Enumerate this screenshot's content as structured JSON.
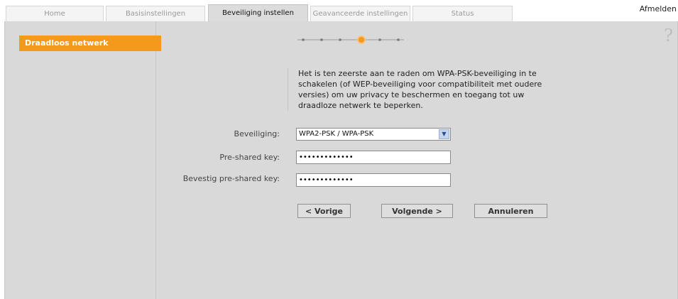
{
  "tabs": [
    {
      "label": "Home",
      "active": false
    },
    {
      "label": "Basisinstellingen",
      "active": false
    },
    {
      "label": "Beveiliging instellen",
      "active": true
    },
    {
      "label": "Geavanceerde instellingen",
      "active": false
    },
    {
      "label": "Status",
      "active": false
    }
  ],
  "header": {
    "logout_label": "Afmelden"
  },
  "sidebar": {
    "items": [
      {
        "label": "Draadloos netwerk",
        "active": true
      }
    ]
  },
  "help": {
    "symbol": "?"
  },
  "wizard": {
    "total_steps": 6,
    "current_step": 4
  },
  "intro_text": "Het is ten zeerste aan te raden om WPA-PSK-beveiliging in te schakelen (of WEP-beveiliging voor compatibiliteit met oudere versies) om uw privacy te beschermen en toegang tot uw draadloze netwerk te beperken.",
  "form": {
    "security": {
      "label": "Beveiliging:",
      "value": "WPA2-PSK / WPA-PSK"
    },
    "psk": {
      "label": "Pre-shared key:",
      "value": "•••••••••••••"
    },
    "psk_confirm": {
      "label": "Bevestig pre-shared key:",
      "value": "•••••••••••••"
    }
  },
  "buttons": {
    "prev": "< Vorige",
    "next": "Volgende >",
    "cancel": "Annuleren"
  },
  "colors": {
    "accent": "#f39a1c",
    "background": "#d9d9d9",
    "step_active": "#f39a1c",
    "step": "#9a9a9a"
  }
}
